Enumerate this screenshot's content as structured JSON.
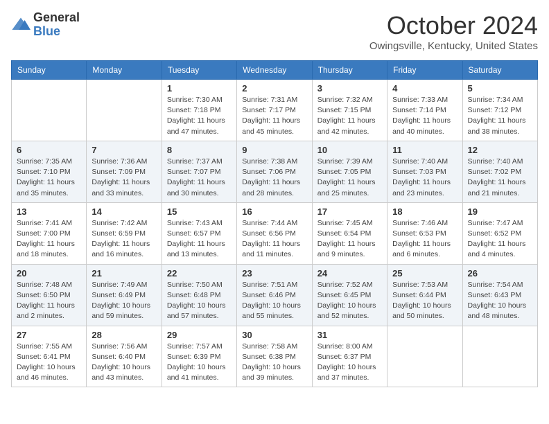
{
  "header": {
    "logo_general": "General",
    "logo_blue": "Blue",
    "month_title": "October 2024",
    "location": "Owingsville, Kentucky, United States"
  },
  "days_of_week": [
    "Sunday",
    "Monday",
    "Tuesday",
    "Wednesday",
    "Thursday",
    "Friday",
    "Saturday"
  ],
  "weeks": [
    [
      {
        "day": "",
        "info": ""
      },
      {
        "day": "",
        "info": ""
      },
      {
        "day": "1",
        "info": "Sunrise: 7:30 AM\nSunset: 7:18 PM\nDaylight: 11 hours and 47 minutes."
      },
      {
        "day": "2",
        "info": "Sunrise: 7:31 AM\nSunset: 7:17 PM\nDaylight: 11 hours and 45 minutes."
      },
      {
        "day": "3",
        "info": "Sunrise: 7:32 AM\nSunset: 7:15 PM\nDaylight: 11 hours and 42 minutes."
      },
      {
        "day": "4",
        "info": "Sunrise: 7:33 AM\nSunset: 7:14 PM\nDaylight: 11 hours and 40 minutes."
      },
      {
        "day": "5",
        "info": "Sunrise: 7:34 AM\nSunset: 7:12 PM\nDaylight: 11 hours and 38 minutes."
      }
    ],
    [
      {
        "day": "6",
        "info": "Sunrise: 7:35 AM\nSunset: 7:10 PM\nDaylight: 11 hours and 35 minutes."
      },
      {
        "day": "7",
        "info": "Sunrise: 7:36 AM\nSunset: 7:09 PM\nDaylight: 11 hours and 33 minutes."
      },
      {
        "day": "8",
        "info": "Sunrise: 7:37 AM\nSunset: 7:07 PM\nDaylight: 11 hours and 30 minutes."
      },
      {
        "day": "9",
        "info": "Sunrise: 7:38 AM\nSunset: 7:06 PM\nDaylight: 11 hours and 28 minutes."
      },
      {
        "day": "10",
        "info": "Sunrise: 7:39 AM\nSunset: 7:05 PM\nDaylight: 11 hours and 25 minutes."
      },
      {
        "day": "11",
        "info": "Sunrise: 7:40 AM\nSunset: 7:03 PM\nDaylight: 11 hours and 23 minutes."
      },
      {
        "day": "12",
        "info": "Sunrise: 7:40 AM\nSunset: 7:02 PM\nDaylight: 11 hours and 21 minutes."
      }
    ],
    [
      {
        "day": "13",
        "info": "Sunrise: 7:41 AM\nSunset: 7:00 PM\nDaylight: 11 hours and 18 minutes."
      },
      {
        "day": "14",
        "info": "Sunrise: 7:42 AM\nSunset: 6:59 PM\nDaylight: 11 hours and 16 minutes."
      },
      {
        "day": "15",
        "info": "Sunrise: 7:43 AM\nSunset: 6:57 PM\nDaylight: 11 hours and 13 minutes."
      },
      {
        "day": "16",
        "info": "Sunrise: 7:44 AM\nSunset: 6:56 PM\nDaylight: 11 hours and 11 minutes."
      },
      {
        "day": "17",
        "info": "Sunrise: 7:45 AM\nSunset: 6:54 PM\nDaylight: 11 hours and 9 minutes."
      },
      {
        "day": "18",
        "info": "Sunrise: 7:46 AM\nSunset: 6:53 PM\nDaylight: 11 hours and 6 minutes."
      },
      {
        "day": "19",
        "info": "Sunrise: 7:47 AM\nSunset: 6:52 PM\nDaylight: 11 hours and 4 minutes."
      }
    ],
    [
      {
        "day": "20",
        "info": "Sunrise: 7:48 AM\nSunset: 6:50 PM\nDaylight: 11 hours and 2 minutes."
      },
      {
        "day": "21",
        "info": "Sunrise: 7:49 AM\nSunset: 6:49 PM\nDaylight: 10 hours and 59 minutes."
      },
      {
        "day": "22",
        "info": "Sunrise: 7:50 AM\nSunset: 6:48 PM\nDaylight: 10 hours and 57 minutes."
      },
      {
        "day": "23",
        "info": "Sunrise: 7:51 AM\nSunset: 6:46 PM\nDaylight: 10 hours and 55 minutes."
      },
      {
        "day": "24",
        "info": "Sunrise: 7:52 AM\nSunset: 6:45 PM\nDaylight: 10 hours and 52 minutes."
      },
      {
        "day": "25",
        "info": "Sunrise: 7:53 AM\nSunset: 6:44 PM\nDaylight: 10 hours and 50 minutes."
      },
      {
        "day": "26",
        "info": "Sunrise: 7:54 AM\nSunset: 6:43 PM\nDaylight: 10 hours and 48 minutes."
      }
    ],
    [
      {
        "day": "27",
        "info": "Sunrise: 7:55 AM\nSunset: 6:41 PM\nDaylight: 10 hours and 46 minutes."
      },
      {
        "day": "28",
        "info": "Sunrise: 7:56 AM\nSunset: 6:40 PM\nDaylight: 10 hours and 43 minutes."
      },
      {
        "day": "29",
        "info": "Sunrise: 7:57 AM\nSunset: 6:39 PM\nDaylight: 10 hours and 41 minutes."
      },
      {
        "day": "30",
        "info": "Sunrise: 7:58 AM\nSunset: 6:38 PM\nDaylight: 10 hours and 39 minutes."
      },
      {
        "day": "31",
        "info": "Sunrise: 8:00 AM\nSunset: 6:37 PM\nDaylight: 10 hours and 37 minutes."
      },
      {
        "day": "",
        "info": ""
      },
      {
        "day": "",
        "info": ""
      }
    ]
  ]
}
